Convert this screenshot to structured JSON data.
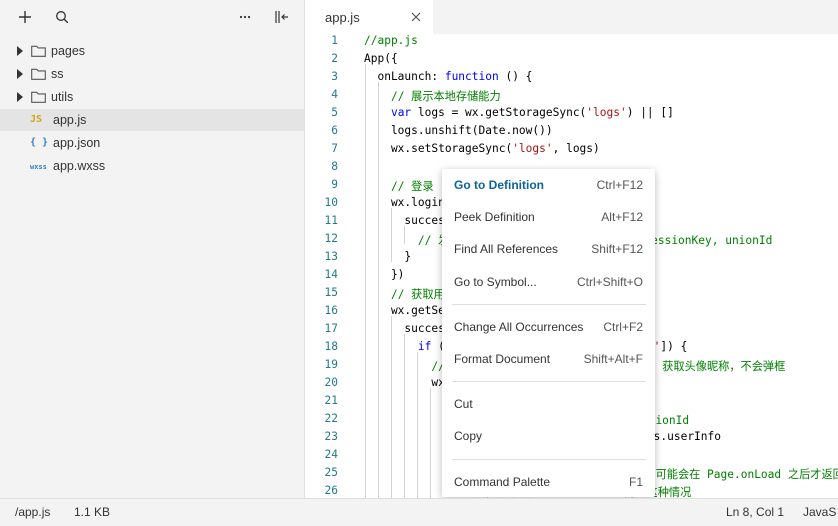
{
  "sidebar": {
    "tree": [
      {
        "label": "pages",
        "type": "folder"
      },
      {
        "label": "ss",
        "type": "folder"
      },
      {
        "label": "utils",
        "type": "folder"
      },
      {
        "label": "app.js",
        "type": "file",
        "icon": "js-file-icon",
        "badge": "JS",
        "selected": true
      },
      {
        "label": "app.json",
        "type": "file",
        "icon": "json-file-icon",
        "badge": "{ }"
      },
      {
        "label": "app.wxss",
        "type": "file",
        "icon": "wxss-file-icon",
        "badge": "wxss"
      }
    ]
  },
  "tab": {
    "label": "app.js"
  },
  "editor": {
    "line_numbers": [
      "1",
      "2",
      "3",
      "4",
      "5",
      "6",
      "7",
      "8",
      "9",
      "10",
      "11",
      "12",
      "13",
      "14",
      "15",
      "16",
      "17",
      "18",
      "19",
      "20",
      "21",
      "22",
      "23",
      "24",
      "25",
      "26"
    ]
  },
  "context_menu": {
    "items": [
      {
        "label": "Go to Definition",
        "shortcut": "Ctrl+F12"
      },
      {
        "label": "Peek Definition",
        "shortcut": "Alt+F12"
      },
      {
        "label": "Find All References",
        "shortcut": "Shift+F12"
      },
      {
        "label": "Go to Symbol...",
        "shortcut": "Ctrl+Shift+O"
      },
      {
        "label": "Change All Occurrences",
        "shortcut": "Ctrl+F2"
      },
      {
        "label": "Format Document",
        "shortcut": "Shift+Alt+F"
      },
      {
        "label": "Cut",
        "shortcut": ""
      },
      {
        "label": "Copy",
        "shortcut": ""
      },
      {
        "label": "Command Palette",
        "shortcut": "F1"
      }
    ]
  },
  "statusbar": {
    "path": "/app.js",
    "size": "1.1 KB",
    "cursor": "Ln 8, Col 1",
    "language": "JavaS"
  },
  "colors": {
    "accent": "#0e639c",
    "comment": "#008000",
    "keyword": "#0000ff",
    "string": "#a31515",
    "line_number": "#237893"
  }
}
